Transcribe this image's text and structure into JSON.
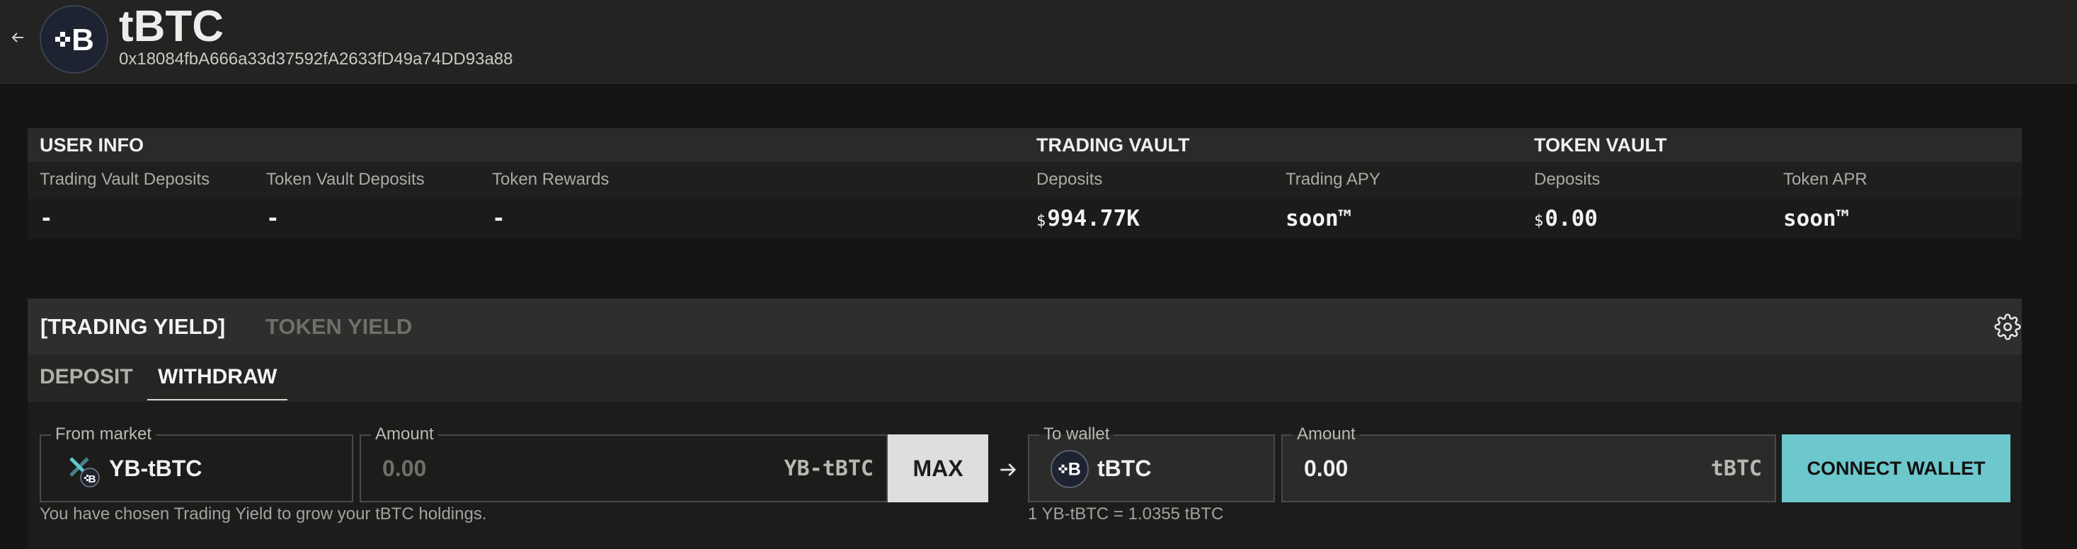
{
  "header": {
    "back_icon": "arrow-left-icon",
    "logo_icon": "tbtc-logo-icon",
    "title": "tBTC",
    "address": "0x18084fbA666a33d37592fA2633fD49a74DD93a88"
  },
  "info": {
    "user": {
      "title": "USER INFO",
      "labels": [
        "Trading Vault Deposits",
        "Token Vault Deposits",
        "Token Rewards"
      ],
      "values": [
        "-",
        "-",
        "-"
      ]
    },
    "trading_vault": {
      "title": "TRADING VAULT",
      "deposits_label": "Deposits",
      "deposits_currency": "$",
      "deposits_value": "994.77K",
      "apy_label": "Trading APY",
      "apy_value": "soon™"
    },
    "token_vault": {
      "title": "TOKEN VAULT",
      "deposits_label": "Deposits",
      "deposits_currency": "$",
      "deposits_value": "0.00",
      "apr_label": "Token APR",
      "apr_value": "soon™"
    }
  },
  "panel": {
    "yield_tabs": [
      "[TRADING YIELD]",
      "TOKEN YIELD"
    ],
    "active_yield_tab": "[TRADING YIELD]",
    "settings_icon": "gear-icon",
    "mode_tabs": [
      "DEPOSIT",
      "WITHDRAW"
    ],
    "active_mode_tab": "WITHDRAW",
    "from": {
      "legend": "From market",
      "token": "YB-tBTC",
      "icon": "yb-tbtc-icon"
    },
    "from_amount": {
      "legend": "Amount",
      "placeholder": "0.00",
      "unit": "YB-tBTC"
    },
    "max_label": "MAX",
    "arrow_icon": "arrow-right-icon",
    "to": {
      "legend": "To wallet",
      "token": "tBTC",
      "icon": "tbtc-logo-icon"
    },
    "to_amount": {
      "legend": "Amount",
      "value": "0.00",
      "unit": "tBTC"
    },
    "connect_label": "CONNECT WALLET",
    "helper_text": "You have chosen Trading Yield to grow your tBTC holdings.",
    "rate_text": "1 YB-tBTC = 1.0355 tBTC"
  },
  "colors": {
    "accent": "#6cc8cc",
    "background": "#141413",
    "header": "#232322"
  }
}
